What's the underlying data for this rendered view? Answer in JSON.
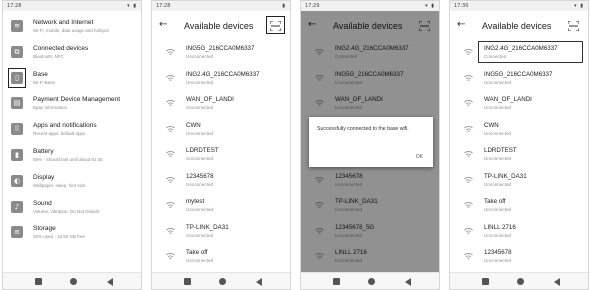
{
  "screens": [
    {
      "status_time": "17:28",
      "settings_items": [
        {
          "title": "Network and Internet",
          "subtitle": "Wi-Fi, mobile, data usage and hotspot",
          "icon": "wifi-icon"
        },
        {
          "title": "Connected devices",
          "subtitle": "Bluetooth, NFC",
          "icon": "connected-devices-icon"
        },
        {
          "title": "Base",
          "subtitle": "Wi-Fi Base",
          "icon": "base-device-icon",
          "highlighted": true
        },
        {
          "title": "Payment Device Management",
          "subtitle": "Epay Information",
          "icon": "payment-device-icon"
        },
        {
          "title": "Apps and notifications",
          "subtitle": "Recent apps, default apps",
          "icon": "apps-grid-icon"
        },
        {
          "title": "Battery",
          "subtitle": "58% - Should last until about 02:45",
          "icon": "battery-icon"
        },
        {
          "title": "Display",
          "subtitle": "Wallpaper, sleep, font size",
          "icon": "display-icon"
        },
        {
          "title": "Sound",
          "subtitle": "Volume, vibration, Do Not Disturb",
          "icon": "sound-icon"
        },
        {
          "title": "Storage",
          "subtitle": "32% used - 10.84 GB free",
          "icon": "storage-icon"
        }
      ]
    },
    {
      "status_time": "17:28",
      "title": "Available devices",
      "devices": [
        {
          "name": "ING5G_216CCA0M6337",
          "status": "Unconnected"
        },
        {
          "name": "ING2.4G_216CCA0M6337",
          "status": "Unconnected"
        },
        {
          "name": "WAN_OF_LANDI",
          "status": "Unconnected"
        },
        {
          "name": "CWN",
          "status": "Unconnected"
        },
        {
          "name": "LDRDTEST",
          "status": "Unconnected"
        },
        {
          "name": "12345678",
          "status": "Unconnected"
        },
        {
          "name": "mytest",
          "status": "Unconnected"
        },
        {
          "name": "TP-LINK_DA31",
          "status": "Unconnected"
        },
        {
          "name": "Take off",
          "status": "Unconnected"
        }
      ]
    },
    {
      "status_time": "17:29",
      "title": "Available devices",
      "devices": [
        {
          "name": "ING2.4G_216CCA0M6337",
          "status": "Connected"
        },
        {
          "name": "ING5G_216CCA0M6337",
          "status": "Unconnected"
        },
        {
          "name": "WAN_OF_LANDI",
          "status": "Unconnected"
        },
        {
          "name": "CWN",
          "status": "Unconnected"
        },
        {
          "name": "LDRDTEST",
          "status": "Unconnected"
        },
        {
          "name": "12345678",
          "status": "Unconnected"
        },
        {
          "name": "TP-LINK_DA31",
          "status": "Unconnected"
        },
        {
          "name": "12345678_5G",
          "status": "Unconnected"
        },
        {
          "name": "LINLL 2716",
          "status": "Unconnected"
        }
      ],
      "dialog": {
        "message": "Successfully connected to the base wifi.",
        "ok_label": "OK"
      }
    },
    {
      "status_time": "17:30",
      "title": "Available devices",
      "devices": [
        {
          "name": "ING2.4G_216CCA0M6337",
          "status": "Connected"
        },
        {
          "name": "ING5G_216CCA0M6337",
          "status": "Unconnected"
        },
        {
          "name": "WAN_OF_LANDI",
          "status": "Unconnected"
        },
        {
          "name": "CWN",
          "status": "Unconnected"
        },
        {
          "name": "LDRDTEST",
          "status": "Unconnected"
        },
        {
          "name": "TP-LINK_DA31",
          "status": "Unconnected"
        },
        {
          "name": "Take off",
          "status": "Unconnected"
        },
        {
          "name": "LINLL 2716",
          "status": "Unconnected"
        },
        {
          "name": "12345678",
          "status": "Unconnected"
        }
      ]
    }
  ]
}
